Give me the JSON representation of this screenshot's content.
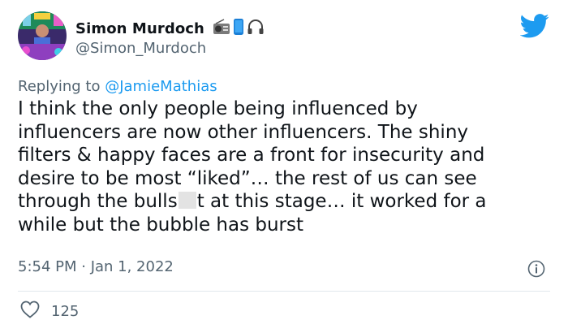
{
  "author": {
    "display_name": "Simon Murdoch",
    "handle": "@Simon_Murdoch",
    "name_emojis": [
      "radio-icon",
      "mobile-phone-icon",
      "headphones-icon"
    ]
  },
  "reply": {
    "prefix": "Replying to",
    "target": "@JamieMathias"
  },
  "tweet": {
    "text_before_censor": "I think the only people being influenced by\ninfluencers are now other influencers. The shiny\nfilters & happy faces are a front for insecurity and\ndesire to be most “liked”… the rest of us can see\nthrough the bulls",
    "text_after_censor": "t at this stage… it worked for a\nwhile but the bubble has burst"
  },
  "meta": {
    "timestamp": "5:54 PM · Jan 1, 2022"
  },
  "engagement": {
    "likes": "125"
  },
  "colors": {
    "brand_blue": "#1d9bf0",
    "text_primary": "#0f1419",
    "text_secondary": "#536471"
  }
}
